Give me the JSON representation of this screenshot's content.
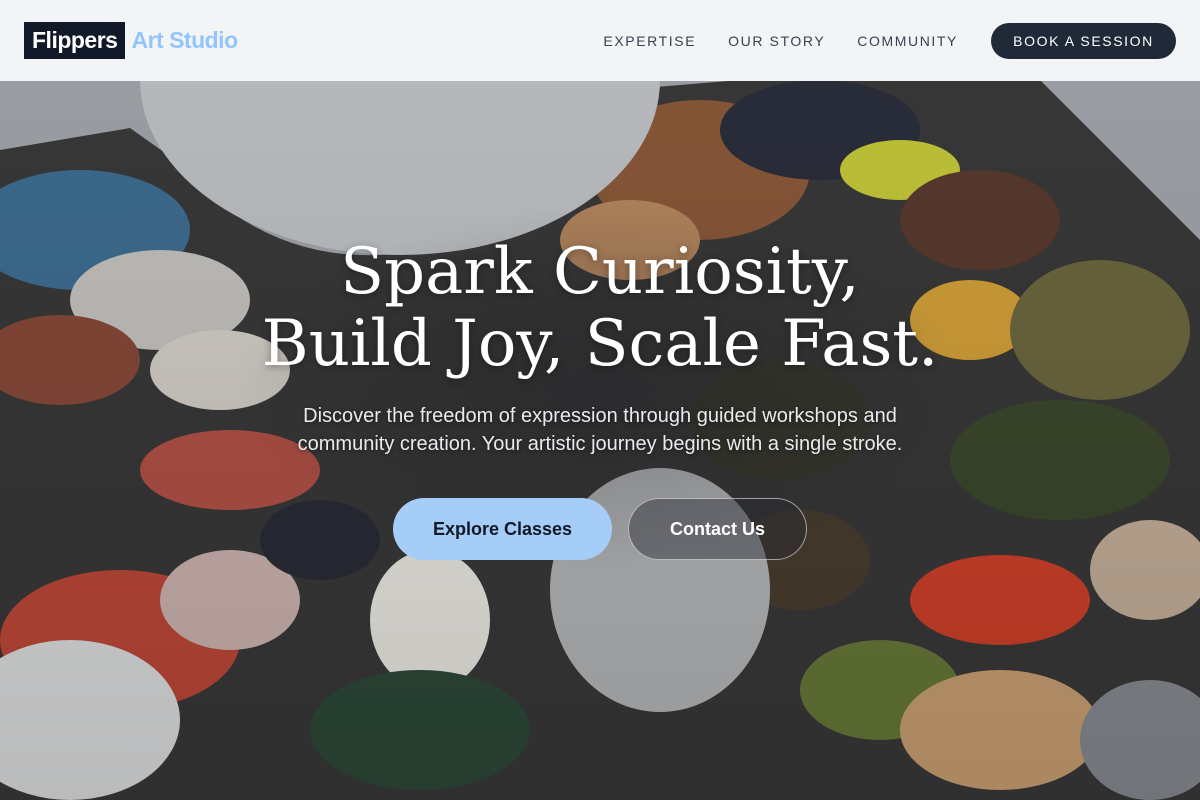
{
  "brand": {
    "name": "Flippers",
    "suffix": "Art Studio"
  },
  "nav": {
    "links": [
      "EXPERTISE",
      "OUR STORY",
      "COMMUNITY"
    ],
    "cta": "BOOK A SESSION"
  },
  "hero": {
    "headline_line1": "Spark Curiosity,",
    "headline_line2": "Build Joy, Scale Fast.",
    "subtext": "Discover the freedom of expression through guided workshops and community creation. Your artistic journey begins with a single stroke.",
    "primary_button": "Explore Classes",
    "secondary_button": "Contact Us"
  },
  "colors": {
    "header_bg": "#f3f4f6",
    "brand_dark": "#111827",
    "brand_accent": "#93c5fd",
    "primary_button": "#a5cdf7",
    "cta_dark": "#1f2937"
  }
}
